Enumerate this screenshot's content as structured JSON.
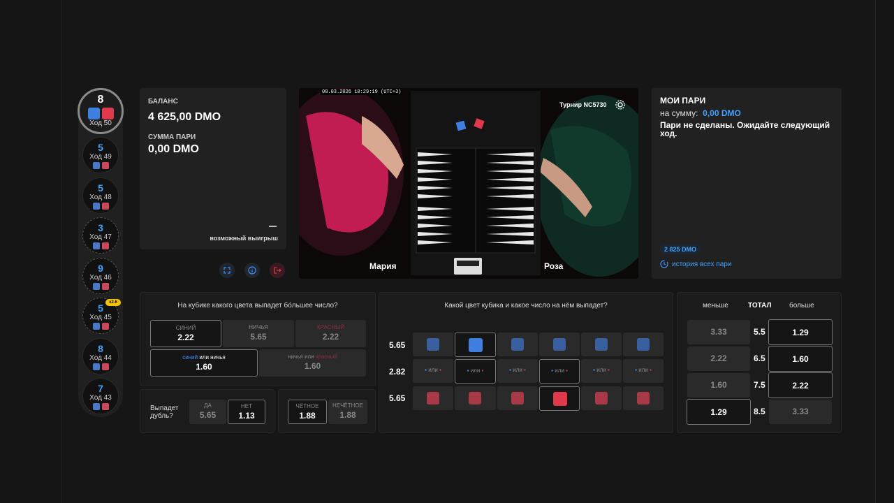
{
  "history": {
    "current": {
      "number": "8",
      "turn": "Ход 50"
    },
    "items": [
      {
        "number": "5",
        "turn": "Ход 49"
      },
      {
        "number": "5",
        "turn": "Ход 48"
      },
      {
        "number": "3",
        "turn": "Ход 47"
      },
      {
        "number": "9",
        "turn": "Ход 46"
      },
      {
        "number": "5",
        "turn": "Ход 45"
      },
      {
        "number": "8",
        "turn": "Ход 44"
      },
      {
        "number": "7",
        "turn": "Ход 43"
      }
    ],
    "badge": "x2.6"
  },
  "balance": {
    "label": "БАЛАНС",
    "value": "4 625,00 DMO",
    "bet_label": "СУММА ПАРИ",
    "bet_value": "0,00 DMO",
    "possible_win": "возможный выигрыш"
  },
  "video": {
    "timestamp": "08.03.2026 10:29:19 (UTC+3)",
    "tournament": "Турнир NC5730",
    "player_left": "Мария",
    "player_right": "Роза"
  },
  "my_bets": {
    "title": "МОИ ПАРИ",
    "sum_label": "на сумму:",
    "sum_value": "0,00 DMO",
    "message": "Пари не сделаны. Ожидайте следующий ход.",
    "chip": "2 825 DMO",
    "history_link": "история всех пари"
  },
  "color_panel": {
    "question": "На кубике какого цвета выпадет бо́льшее число?",
    "blue": {
      "label": "СИНИЙ",
      "odds": "2.22"
    },
    "draw": {
      "label": "НИЧЬЯ",
      "odds": "5.65"
    },
    "red": {
      "label": "КРАСНЫЙ",
      "odds": "2.22"
    },
    "blue_or_draw": {
      "a": "синий",
      "or": "или",
      "b": "ничья",
      "odds": "1.60"
    },
    "draw_or_red": {
      "a": "ничья",
      "or": "или",
      "b": "красный",
      "odds": "1.60"
    }
  },
  "double_panel": {
    "question_line1": "Выпадет",
    "question_line2": "дубль?",
    "yes": {
      "label": "ДА",
      "odds": "5.65"
    },
    "no": {
      "label": "НЕТ",
      "odds": "1.13"
    }
  },
  "parity_panel": {
    "even": {
      "label": "ЧЁТНОЕ",
      "odds": "1.88"
    },
    "odd": {
      "label": "НЕЧЁТНОЕ",
      "odds": "1.88"
    }
  },
  "dice_panel": {
    "question": "Какой цвет кубика и какое число на нём выпадет?",
    "row_odds": [
      "5.65",
      "2.82",
      "5.65"
    ],
    "or": "или"
  },
  "total_panel": {
    "less": "меньше",
    "total": "ТОТАЛ",
    "more": "больше",
    "rows": [
      {
        "less": "3.33",
        "total": "5.5",
        "more": "1.29"
      },
      {
        "less": "2.22",
        "total": "6.5",
        "more": "1.60"
      },
      {
        "less": "1.60",
        "total": "7.5",
        "more": "2.22"
      },
      {
        "less": "1.29",
        "total": "8.5",
        "more": "3.33"
      }
    ]
  }
}
